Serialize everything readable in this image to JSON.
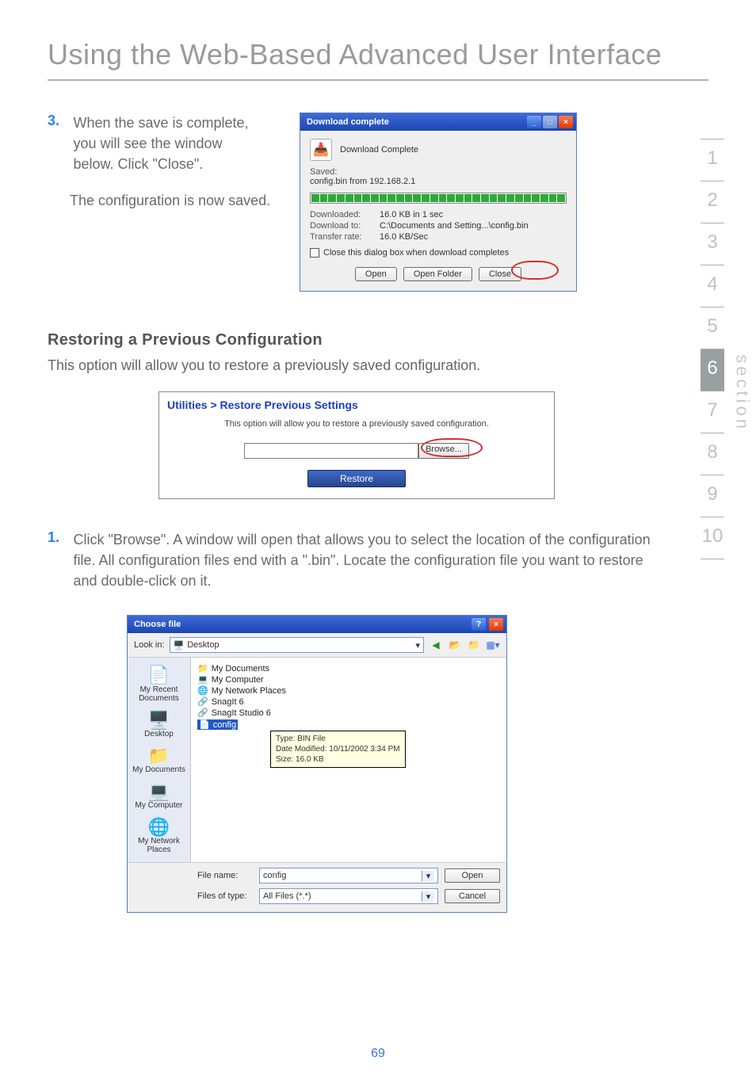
{
  "page": {
    "title": "Using the Web-Based Advanced User Interface",
    "number": "69"
  },
  "side_nav": {
    "label": "section",
    "items": [
      "1",
      "2",
      "3",
      "4",
      "5",
      "6",
      "7",
      "8",
      "9",
      "10"
    ],
    "active_index": 5
  },
  "step3": {
    "num": "3.",
    "text1": "When the save is complete, you will see the window below. Click \"Close\".",
    "text2": "The configuration is now saved."
  },
  "download_dialog": {
    "title": "Download complete",
    "header": "Download Complete",
    "saved_label": "Saved:",
    "saved_value": "config.bin from 192.168.2.1",
    "rows": [
      {
        "label": "Downloaded:",
        "value": "16.0 KB in 1 sec"
      },
      {
        "label": "Download to:",
        "value": "C:\\Documents and Setting...\\config.bin"
      },
      {
        "label": "Transfer rate:",
        "value": "16.0 KB/Sec"
      }
    ],
    "checkbox_label": "Close this dialog box when download completes",
    "buttons": {
      "open": "Open",
      "open_folder": "Open Folder",
      "close": "Close"
    }
  },
  "restore_heading": "Restoring a Previous Configuration",
  "restore_intro": "This option will allow you to restore a previously saved configuration.",
  "restore_panel": {
    "title": "Utilities > Restore Previous Settings",
    "desc": "This option will allow you to restore a previously saved configuration.",
    "browse": "Browse...",
    "restore": "Restore"
  },
  "step1": {
    "num": "1.",
    "text": "Click \"Browse\". A window will open that allows you to select the location of the configuration file. All configuration files end with a \".bin\". Locate the configuration file you want to restore and double-click on it."
  },
  "choose_dialog": {
    "title": "Choose file",
    "lookin_label": "Look in:",
    "lookin_value": "Desktop",
    "places": [
      {
        "icon": "📄",
        "label": "My Recent Documents"
      },
      {
        "icon": "🖥️",
        "label": "Desktop"
      },
      {
        "icon": "📁",
        "label": "My Documents"
      },
      {
        "icon": "💻",
        "label": "My Computer"
      },
      {
        "icon": "🌐",
        "label": "My Network Places"
      }
    ],
    "files": [
      {
        "icon": "📁",
        "name": "My Documents"
      },
      {
        "icon": "💻",
        "name": "My Computer"
      },
      {
        "icon": "🌐",
        "name": "My Network Places"
      },
      {
        "icon": "🔗",
        "name": "SnagIt 6"
      },
      {
        "icon": "🔗",
        "name": "SnagIt Studio 6"
      },
      {
        "icon": "📄",
        "name": "config",
        "selected": true
      }
    ],
    "tooltip": {
      "l1": "Type: BIN File",
      "l2": "Date Modified: 10/11/2002 3:34 PM",
      "l3": "Size: 16.0 KB"
    },
    "filename_label": "File name:",
    "filename_value": "config",
    "filetype_label": "Files of type:",
    "filetype_value": "All Files (*.*)",
    "open_btn": "Open",
    "cancel_btn": "Cancel"
  }
}
